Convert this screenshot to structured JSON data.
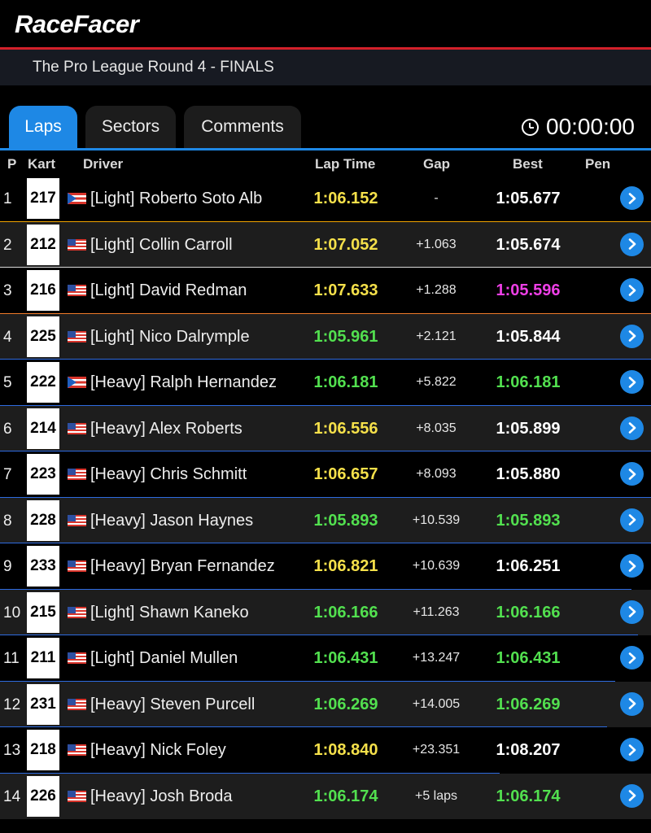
{
  "app": {
    "logo": "RaceFacer"
  },
  "event": {
    "title": "The Pro League Round 4 - FINALS"
  },
  "tabs": [
    {
      "label": "Laps",
      "active": true
    },
    {
      "label": "Sectors",
      "active": false
    },
    {
      "label": "Comments",
      "active": false
    }
  ],
  "timer": {
    "value": "00:00:00",
    "icon": "clock-icon"
  },
  "columns": {
    "pos": "P",
    "kart": "Kart",
    "driver": "Driver",
    "lap_time": "Lap Time",
    "gap": "Gap",
    "best": "Best",
    "pen": "Pen"
  },
  "colors": {
    "yellow": "#f5e04a",
    "green": "#52e04f",
    "magenta": "#ee3fe6",
    "white": "#ffffff",
    "accent": "#1e88e5",
    "brand_red": "#d3202a"
  },
  "rows": [
    {
      "pos": "1",
      "kart": "217",
      "flag": "pr",
      "driver": "[Light] Roberto Soto Alb",
      "lap_time": "1:06.152",
      "lap_color": "yellow",
      "gap": "-",
      "best": "1:05.677",
      "best_color": "white"
    },
    {
      "pos": "2",
      "kart": "212",
      "flag": "us",
      "driver": "[Light] Collin Carroll",
      "lap_time": "1:07.052",
      "lap_color": "yellow",
      "gap": "+1.063",
      "best": "1:05.674",
      "best_color": "white"
    },
    {
      "pos": "3",
      "kart": "216",
      "flag": "us",
      "driver": "[Light] David Redman",
      "lap_time": "1:07.633",
      "lap_color": "yellow",
      "gap": "+1.288",
      "best": "1:05.596",
      "best_color": "magenta"
    },
    {
      "pos": "4",
      "kart": "225",
      "flag": "us",
      "driver": "[Light] Nico Dalrymple",
      "lap_time": "1:05.961",
      "lap_color": "green",
      "gap": "+2.121",
      "best": "1:05.844",
      "best_color": "white"
    },
    {
      "pos": "5",
      "kart": "222",
      "flag": "pr",
      "driver": "[Heavy] Ralph Hernandez",
      "lap_time": "1:06.181",
      "lap_color": "green",
      "gap": "+5.822",
      "best": "1:06.181",
      "best_color": "green"
    },
    {
      "pos": "6",
      "kart": "214",
      "flag": "us",
      "driver": "[Heavy] Alex Roberts",
      "lap_time": "1:06.556",
      "lap_color": "yellow",
      "gap": "+8.035",
      "best": "1:05.899",
      "best_color": "white"
    },
    {
      "pos": "7",
      "kart": "223",
      "flag": "us",
      "driver": "[Heavy] Chris Schmitt",
      "lap_time": "1:06.657",
      "lap_color": "yellow",
      "gap": "+8.093",
      "best": "1:05.880",
      "best_color": "white"
    },
    {
      "pos": "8",
      "kart": "228",
      "flag": "us",
      "driver": "[Heavy] Jason Haynes",
      "lap_time": "1:05.893",
      "lap_color": "green",
      "gap": "+10.539",
      "best": "1:05.893",
      "best_color": "green"
    },
    {
      "pos": "9",
      "kart": "233",
      "flag": "us",
      "driver": "[Heavy] Bryan Fernandez",
      "lap_time": "1:06.821",
      "lap_color": "yellow",
      "gap": "+10.639",
      "best": "1:06.251",
      "best_color": "white"
    },
    {
      "pos": "10",
      "kart": "215",
      "flag": "us",
      "driver": "[Light] Shawn Kaneko",
      "lap_time": "1:06.166",
      "lap_color": "green",
      "gap": "+11.263",
      "best": "1:06.166",
      "best_color": "green"
    },
    {
      "pos": "11",
      "kart": "211",
      "flag": "us",
      "driver": "[Light] Daniel Mullen",
      "lap_time": "1:06.431",
      "lap_color": "green",
      "gap": "+13.247",
      "best": "1:06.431",
      "best_color": "green"
    },
    {
      "pos": "12",
      "kart": "231",
      "flag": "us",
      "driver": "[Heavy] Steven Purcell",
      "lap_time": "1:06.269",
      "lap_color": "green",
      "gap": "+14.005",
      "best": "1:06.269",
      "best_color": "green"
    },
    {
      "pos": "13",
      "kart": "218",
      "flag": "us",
      "driver": "[Heavy] Nick Foley",
      "lap_time": "1:08.840",
      "lap_color": "yellow",
      "gap": "+23.351",
      "best": "1:08.207",
      "best_color": "white"
    },
    {
      "pos": "14",
      "kart": "226",
      "flag": "us",
      "driver": "[Heavy] Josh Broda",
      "lap_time": "1:06.174",
      "lap_color": "green",
      "gap": "+5 laps",
      "best": "1:06.174",
      "best_color": "green"
    }
  ]
}
